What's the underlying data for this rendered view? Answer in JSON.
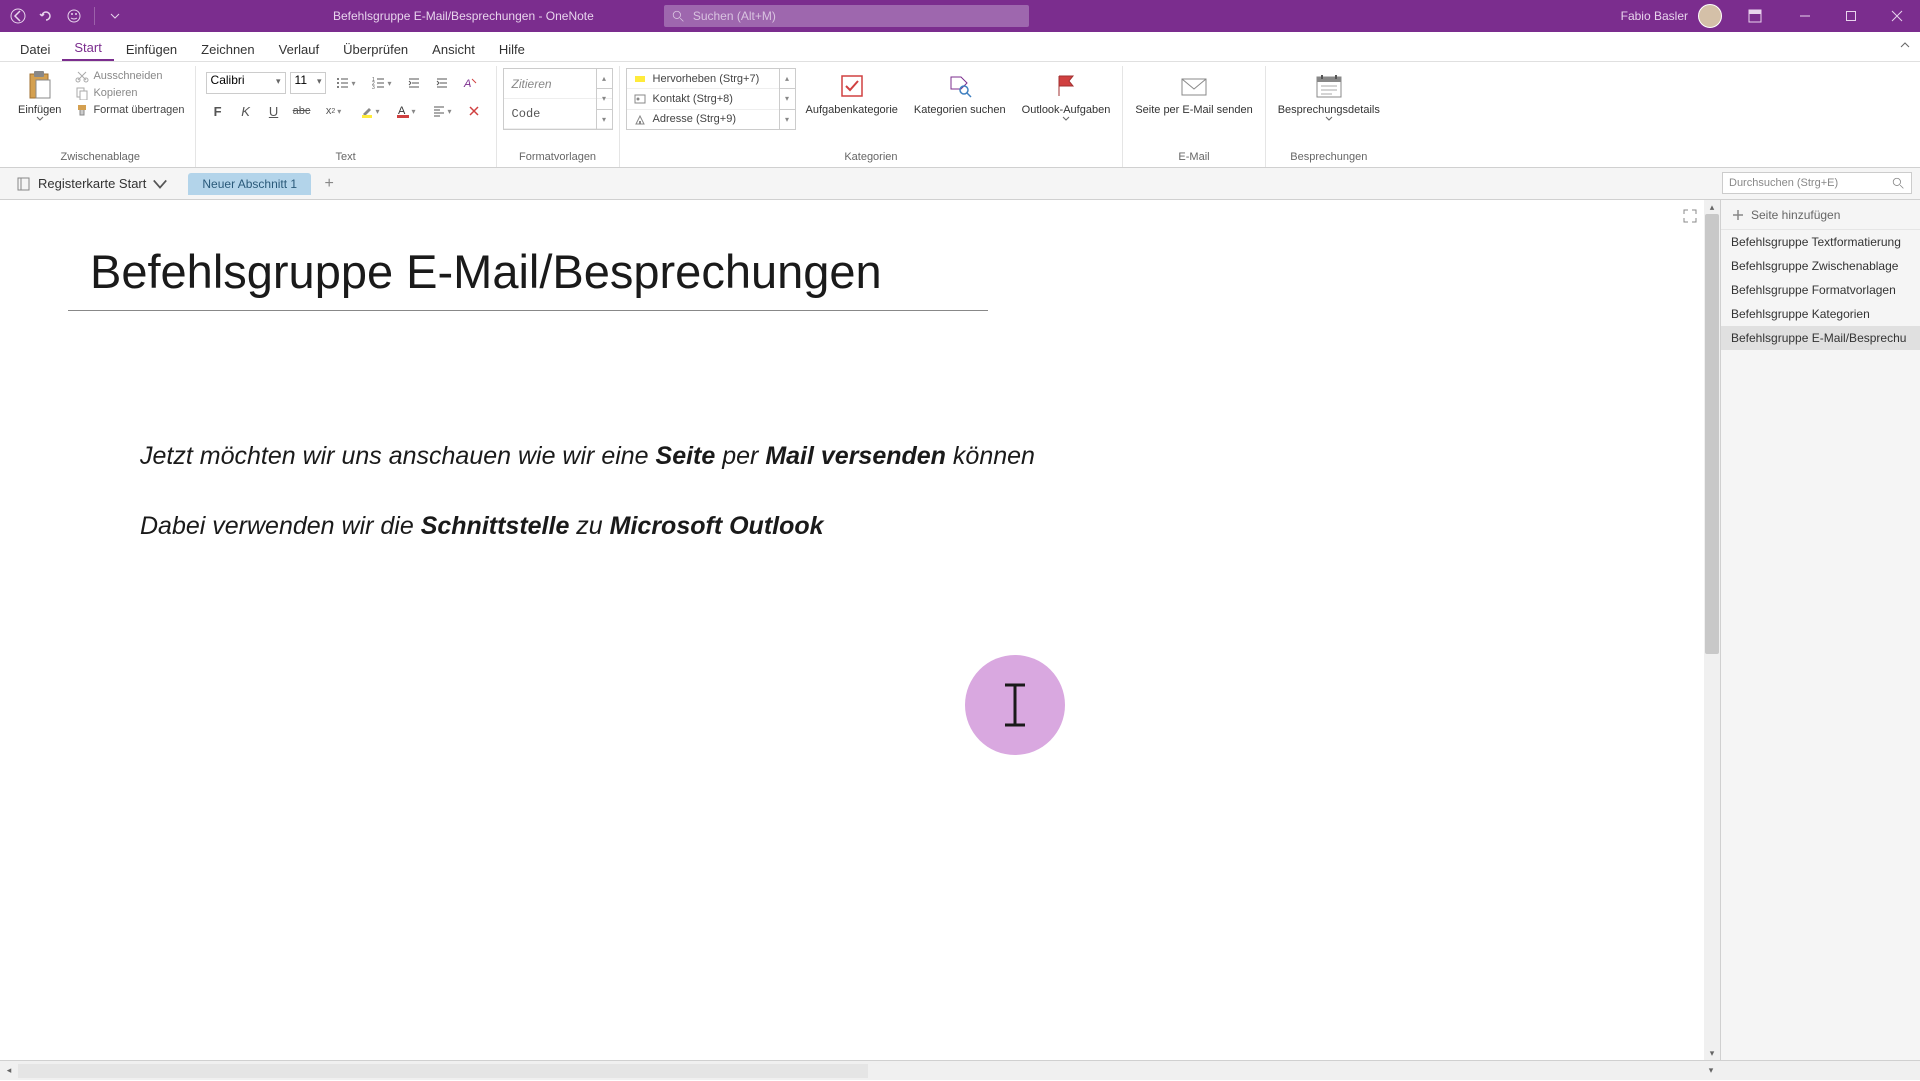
{
  "titleBar": {
    "docTitle": "Befehlsgruppe E-Mail/Besprechungen  -  OneNote",
    "searchPlaceholder": "Suchen (Alt+M)",
    "userName": "Fabio Basler"
  },
  "ribbonTabs": [
    "Datei",
    "Start",
    "Einfügen",
    "Zeichnen",
    "Verlauf",
    "Überprüfen",
    "Ansicht",
    "Hilfe"
  ],
  "activeTab": "Start",
  "ribbon": {
    "clipboard": {
      "paste": "Einfügen",
      "cut": "Ausschneiden",
      "copy": "Kopieren",
      "formatPainter": "Format übertragen",
      "groupLabel": "Zwischenablage"
    },
    "text": {
      "font": "Calibri",
      "size": "11",
      "groupLabel": "Text"
    },
    "styles": {
      "item1": "Zitieren",
      "item2": "Code",
      "groupLabel": "Formatvorlagen"
    },
    "tags": {
      "item1": "Hervorheben (Strg+7)",
      "item2": "Kontakt (Strg+8)",
      "item3": "Adresse (Strg+9)",
      "taskCategory": "Aufgabenkategorie",
      "findCategories": "Kategorien suchen",
      "outlookTasks": "Outlook-Aufgaben",
      "groupLabel": "Kategorien"
    },
    "email": {
      "sendPage": "Seite per E-Mail senden",
      "groupLabel": "E-Mail"
    },
    "meetings": {
      "details": "Besprechungsdetails",
      "groupLabel": "Besprechungen"
    }
  },
  "notebookNav": {
    "name": "Registerkarte Start",
    "section": "Neuer Abschnitt 1",
    "searchPlaceholder": "Durchsuchen (Strg+E)"
  },
  "pageList": {
    "addPage": "Seite hinzufügen",
    "pages": [
      "Befehlsgruppe Textformatierung",
      "Befehlsgruppe Zwischenablage",
      "Befehlsgruppe Formatvorlagen",
      "Befehlsgruppe Kategorien",
      "Befehlsgruppe E-Mail/Besprechu"
    ],
    "selectedIndex": 4
  },
  "document": {
    "title": "Befehlsgruppe E-Mail/Besprechungen",
    "line1_a": "Jetzt möchten wir uns anschauen wie wir eine ",
    "line1_b": "Seite",
    "line1_c": " per ",
    "line1_d": "Mail versenden",
    "line1_e": " können",
    "line2_a": "Dabei verwenden wir die ",
    "line2_b": "Schnittstelle",
    "line2_c": " zu ",
    "line2_d": "Microsoft Outlook"
  }
}
